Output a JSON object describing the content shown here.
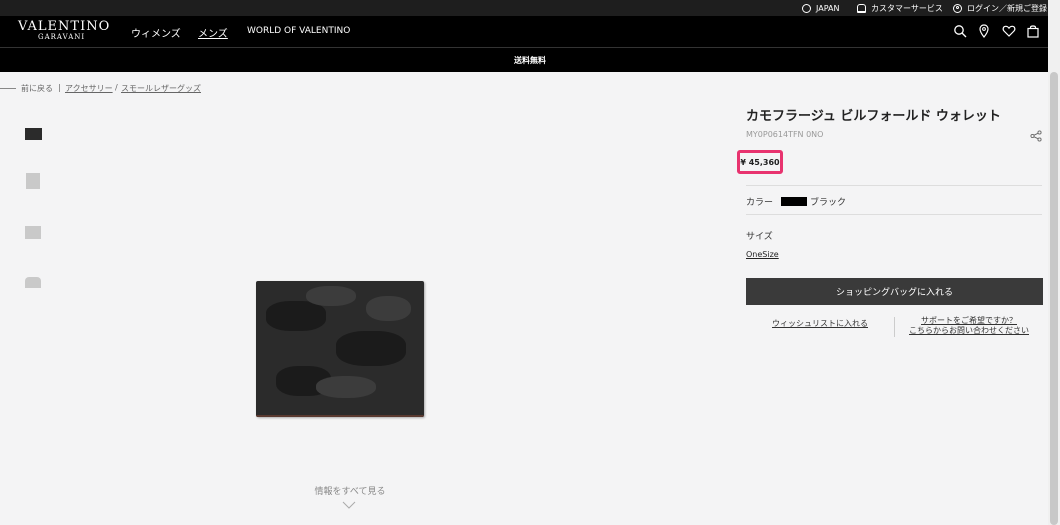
{
  "utility_bar": {
    "region": "JAPAN",
    "customer_service": "カスタマーサービス",
    "login": "ログイン／新規ご登録"
  },
  "header": {
    "logo_main": "VALENTINO",
    "logo_sub": "GARAVANI",
    "nav": [
      "ウィメンズ",
      "メンズ",
      "WORLD OF VALENTINO"
    ],
    "icons": [
      "search-icon",
      "location-icon",
      "heart-icon",
      "bag-icon"
    ]
  },
  "promo": {
    "shipping": "送料無料"
  },
  "breadcrumb": {
    "back": "前に戻る",
    "sep1": "|",
    "item1": "アクセサリー",
    "sep2": "/",
    "item2": "スモールレザーグッズ"
  },
  "gallery": {
    "more_info": "情報をすべて見る"
  },
  "product": {
    "title": "カモフラージュ ビルフォールド ウォレット",
    "code": "MY0P0614TFN 0NO",
    "price": "¥ 45,360",
    "color_label": "カラー",
    "color_value": "ブラック",
    "size_label": "サイズ",
    "size_value": "OneSize",
    "add_to_cart": "ショッピングバッグに入れる",
    "wishlist": "ウィッシュリストに入れる",
    "support_line1": "サポートをご希望ですか？",
    "support_line2": "こちらからお問い合わせください"
  },
  "colors": {
    "accent": "#e8336f",
    "button": "#3a3a3a",
    "header": "#000000"
  }
}
